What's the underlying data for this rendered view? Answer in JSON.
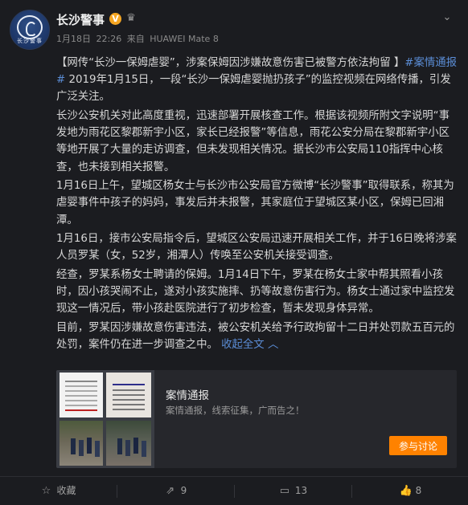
{
  "author": {
    "name": "长沙警事",
    "avatar_text": "长沙警事"
  },
  "meta": {
    "date": "1月18日",
    "time": "22:26",
    "via": "来自",
    "device": "HUAWEI Mate 8"
  },
  "post": {
    "p1_lead": "【网传“长沙一保姆虐婴”，涉案保姆因涉嫌故意伤害已被警方依法拘留 】",
    "p1_hashtag": "#案情通报#",
    "p1_rest": " 2019年1月15日，一段“长沙一保姆虐婴抛扔孩子”的监控视频在网络传播，引发广泛关注。",
    "p2": "长沙公安机关对此高度重视，迅速部署开展核查工作。根据该视频所附文字说明“事发地为雨花区黎郡新宇小区，家长已经报警”等信息，雨花公安分局在黎郡新宇小区等地开展了大量的走访调查，但未发现相关情况。据长沙市公安局110指挥中心核查，也未接到相关报警。",
    "p3": "1月16日上午，望城区杨女士与长沙市公安局官方微博“长沙警事”取得联系，称其为虐婴事件中孩子的妈妈，事发后并未报警，其家庭位于望城区某小区，保姆已回湘潭。",
    "p4": "1月16日，接市公安局指令后，望城区公安局迅速开展相关工作，并于16日晚将涉案人员罗某（女，52岁，湘潭人）传唤至公安机关接受调查。",
    "p5": "经查，罗某系杨女士聘请的保姆。1月14日下午，罗某在杨女士家中帮其照看小孩时，因小孩哭闹不止，遂对小孩实施摔、扔等故意伤害行为。杨女士通过家中监控发现这一情况后，带小孩赴医院进行了初步检查，暂未发现身体异常。",
    "p6": "目前，罗某因涉嫌故意伤害违法，被公安机关给予行政拘留十二日并处罚款五百元的处罚，案件仍在进一步调查之中。",
    "collapse_label": "收起全文",
    "collapse_arrow": "︿"
  },
  "card": {
    "title": "案情通报",
    "description": "案情通报，线索征集，广而告之！",
    "button_label": "参与讨论"
  },
  "actions": {
    "favorite": "收藏",
    "repost": "9",
    "comment": "13",
    "like": "8"
  },
  "icons": {
    "verified": "verified-v-icon",
    "crown": "member-crown-icon",
    "more": "chevron-down-icon",
    "favorite": "star-icon",
    "repost": "repost-icon",
    "comment": "comment-icon",
    "like": "thumbs-up-icon"
  },
  "colors": {
    "background": "#1b1c20",
    "link": "#5b8dd6",
    "accent_button": "#ff8200",
    "verified_badge": "#f5a623"
  }
}
